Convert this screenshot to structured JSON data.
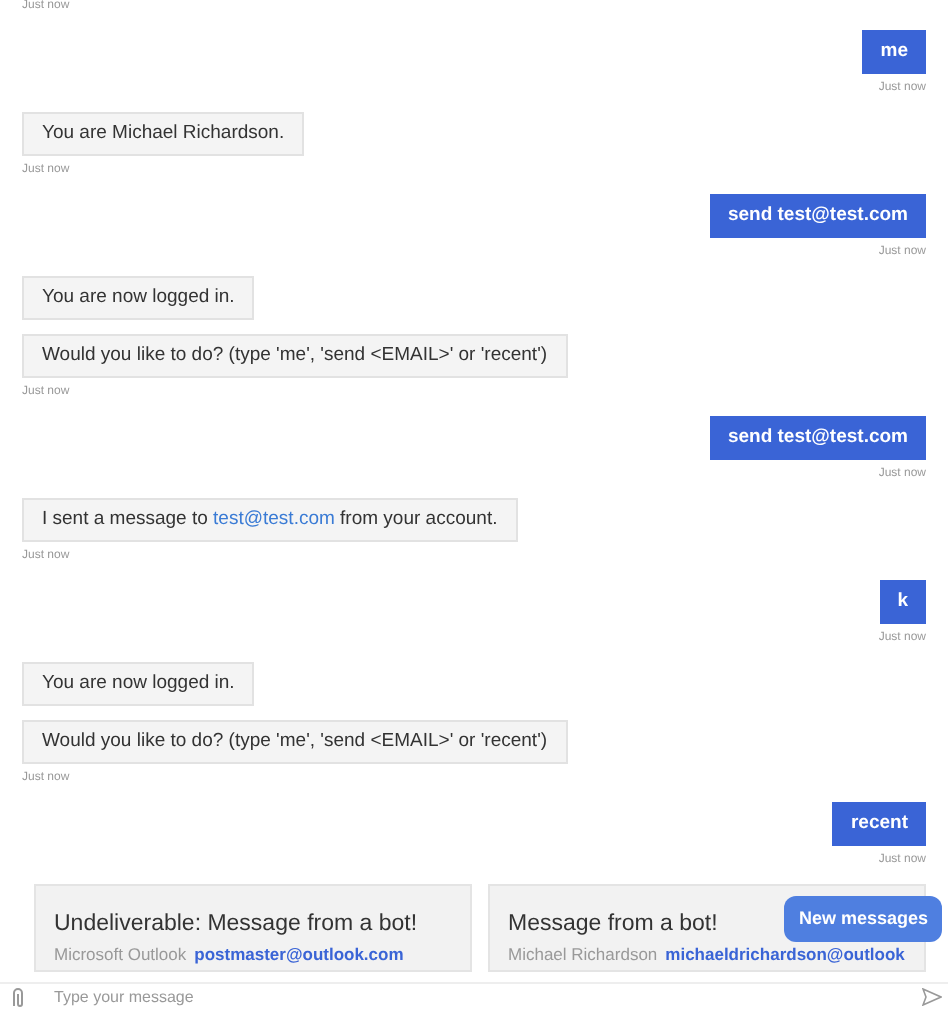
{
  "messages": [
    {
      "kind": "bot",
      "timestamp": "Just now"
    },
    {
      "kind": "user",
      "parts": [
        {
          "text": "me"
        }
      ],
      "timestamp": "Just now"
    },
    {
      "kind": "bot",
      "parts": [
        {
          "text": "You are Michael Richardson."
        }
      ],
      "timestamp": "Just now"
    },
    {
      "kind": "user",
      "parts": [
        {
          "text": "send test@test.com"
        }
      ],
      "timestamp": "Just now"
    },
    {
      "kind": "bot",
      "parts": [
        {
          "text": "You are now logged in."
        }
      ]
    },
    {
      "kind": "bot",
      "parts": [
        {
          "text": "Would you like to do? (type 'me', 'send <EMAIL>' or 'recent')"
        }
      ],
      "timestamp": "Just now"
    },
    {
      "kind": "user",
      "parts": [
        {
          "text": "send test@test.com"
        }
      ],
      "timestamp": "Just now"
    },
    {
      "kind": "bot",
      "parts": [
        {
          "text": "I sent a message to "
        },
        {
          "text": "test@test.com",
          "kind": "link"
        },
        {
          "text": " from your account."
        }
      ],
      "timestamp": "Just now"
    },
    {
      "kind": "user",
      "parts": [
        {
          "text": "k"
        }
      ],
      "timestamp": "Just now"
    },
    {
      "kind": "bot",
      "parts": [
        {
          "text": "You are now logged in."
        }
      ]
    },
    {
      "kind": "bot",
      "parts": [
        {
          "text": "Would you like to do? (type 'me', 'send <EMAIL>' or 'recent')"
        }
      ],
      "timestamp": "Just now"
    },
    {
      "kind": "user",
      "parts": [
        {
          "text": "recent"
        }
      ],
      "timestamp": "Just now"
    }
  ],
  "cards": [
    {
      "title": "Undeliverable: Message from a bot!",
      "sender": "Microsoft Outlook",
      "email": "postmaster@outlook.com"
    },
    {
      "title": "Message from a bot!",
      "sender": "Michael Richardson",
      "email": "michaeldrichardson@outlook"
    }
  ],
  "new_messages_button": "New messages",
  "input": {
    "placeholder": "Type your message"
  }
}
